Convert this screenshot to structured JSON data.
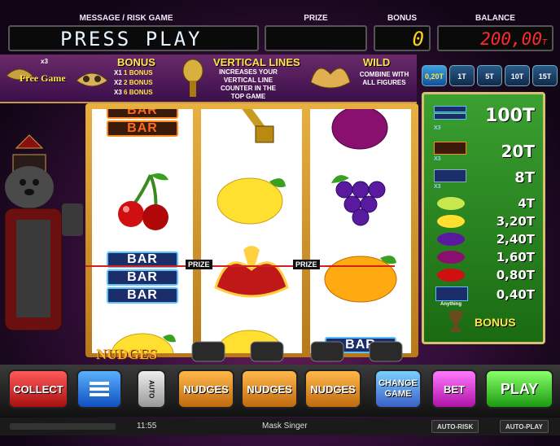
{
  "header": {
    "message_label": "MESSAGE / RISK GAME",
    "message_text": "PRESS PLAY",
    "prize_label": "PRIZE",
    "prize_value": "",
    "bonus_label": "BONUS",
    "bonus_value": "0",
    "balance_label": "BALANCE",
    "balance_value": "200,00",
    "balance_currency": "T"
  },
  "info": {
    "free_game_label": "Free Game",
    "free_game_multiplier": "x3",
    "bonus_title": "BONUS",
    "bonus_rows": [
      {
        "mult": "X1",
        "text": "1 BONUS"
      },
      {
        "mult": "X2",
        "text": "2 BONUS"
      },
      {
        "mult": "X3",
        "text": "6 BONUS"
      }
    ],
    "vertical_title": "VERTICAL LINES",
    "vertical_desc": "INCREASES YOUR VERTICAL LINE COUNTER IN THE TOP GAME",
    "wild_title": "WILD",
    "wild_desc": "COMBINE WITH ALL FIGURES"
  },
  "bet_options": [
    "0,20T",
    "1T",
    "5T",
    "10T",
    "15T"
  ],
  "reels": {
    "bar_label": "BAR",
    "prize_tag": "PRIZE"
  },
  "paytable": {
    "rows": [
      {
        "icon": "bar-bar-bar-icon",
        "mult": "X3",
        "value": "100T"
      },
      {
        "icon": "bar-orange-icon",
        "mult": "X3",
        "value": "20T"
      },
      {
        "icon": "bar-mixed-icon",
        "mult": "X3",
        "value": "8T"
      },
      {
        "icon": "melon-icon",
        "mult": "",
        "value": "4T"
      },
      {
        "icon": "lemon-icon",
        "mult": "",
        "value": "3,20T"
      },
      {
        "icon": "grapes-icon",
        "mult": "",
        "value": "2,40T"
      },
      {
        "icon": "plum-icon",
        "mult": "",
        "value": "1,60T"
      },
      {
        "icon": "cherries-icon",
        "mult": "",
        "value": "0,80T"
      },
      {
        "icon": "bar-any-icon",
        "mult": "",
        "value": "0,40T"
      }
    ],
    "anything_label": "Anything",
    "bonus_label": "BONUS"
  },
  "nudges_label": "NUDGES",
  "buttons": {
    "collect": "COLLECT",
    "auto": "AUTO",
    "nudges": "NUDGES",
    "change_game": "CHANGE GAME",
    "bet": "BET",
    "play": "PLAY"
  },
  "status": {
    "time": "11:55",
    "game_name": "Mask Singer",
    "auto_risk": "AUTO-RISK",
    "auto_play": "AUTO-PLAY"
  },
  "colors": {
    "accent_yellow": "#ffe44a",
    "balance_red": "#ff2a2a",
    "paytable_green": "#2a8a20"
  }
}
